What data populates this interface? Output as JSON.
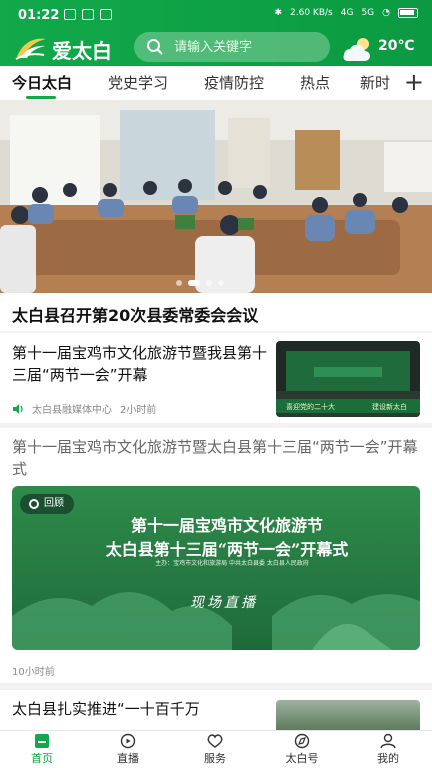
{
  "status_bar": {
    "time": "01:22",
    "network_speed": "2.60 KB/s",
    "network_type": "4G",
    "signal": "5G"
  },
  "app": {
    "title": "爱太白"
  },
  "search": {
    "placeholder": "请输入关键字"
  },
  "weather": {
    "icon": "cloud-sun-icon",
    "temperature": "20℃"
  },
  "tabs": [
    {
      "label": "今日太白",
      "active": true
    },
    {
      "label": "党史学习",
      "active": false
    },
    {
      "label": "疫情防控",
      "active": false
    },
    {
      "label": "热点",
      "active": false
    },
    {
      "label": "新时",
      "active": false
    }
  ],
  "tab_add_icon": "plus-icon",
  "banner": {
    "caption": "太白县召开第20次县委常委会会议",
    "slide_count": 4,
    "active_slide": 1
  },
  "news_items": [
    {
      "title": "第十一届宝鸡市文化旅游节暨我县第十三届“两节一会”开幕",
      "source": "太白县融媒体中心",
      "time": "2小时前",
      "thumb_caption_left": "喜迎党的二十大",
      "thumb_caption_right": "建设新太白"
    },
    {
      "title": "第十一届宝鸡市文化旅游节暨太白县第十三届“两节一会”开幕式",
      "replay_label": "回顾",
      "poster_line1": "第十一届宝鸡市文化旅游节",
      "poster_line2": "太白县第十三届“两节一会”开幕式",
      "poster_org": "主办：宝鸡市文化和旅游局 中共太白县委 太白县人民政府",
      "poster_live": "现场直播",
      "time": "10小时前"
    },
    {
      "title": "太白县扎实推进“一十百千万"
    }
  ],
  "bottom_nav": [
    {
      "label": "首页",
      "icon": "home-icon",
      "active": true
    },
    {
      "label": "直播",
      "icon": "live-icon",
      "active": false
    },
    {
      "label": "服务",
      "icon": "heart-service-icon",
      "active": false
    },
    {
      "label": "太白号",
      "icon": "compass-icon",
      "active": false
    },
    {
      "label": "我的",
      "icon": "user-icon",
      "active": false
    }
  ],
  "colors": {
    "brand_green": "#11a94a",
    "active_nav": "#11a94a"
  }
}
